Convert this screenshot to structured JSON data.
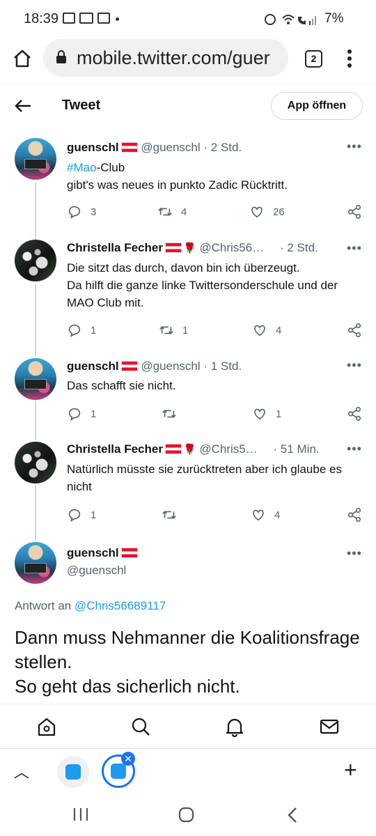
{
  "status_bar": {
    "time": "18:39",
    "battery": "7%"
  },
  "browser": {
    "url": "mobile.twitter.com/guer",
    "tab_count": "2"
  },
  "header": {
    "title": "Tweet",
    "app_button": "App öffnen"
  },
  "tweets": [
    {
      "name": "guenschl",
      "handle": "@guenschl · 2 Std.",
      "hashtag": "#Mao",
      "text_line1_rest": "-Club",
      "text_line2": "gibt's was neues in punkto Zadic Rücktritt.",
      "replies": "3",
      "retweets": "4",
      "likes": "26"
    },
    {
      "name": "Christella Fecher",
      "handle": "@Chris56…",
      "time": "· 2 Std.",
      "text": "Die sitzt das durch, davon bin ich überzeugt.\nDa hilft die ganze linke Twittersonderschule und der MAO Club mit.",
      "replies": "1",
      "retweets": "1",
      "likes": "4"
    },
    {
      "name": "guenschl",
      "handle": "@guenschl · 1 Std.",
      "text": "Das schafft sie nicht.",
      "replies": "1",
      "retweets": "",
      "likes": "1"
    },
    {
      "name": "Christella Fecher",
      "handle": "@Chris5…",
      "time": "· 51 Min.",
      "text": "Natürlich müsste sie zurücktreten aber ich glaube es nicht",
      "replies": "1",
      "retweets": "",
      "likes": "4"
    }
  ],
  "main_tweet": {
    "name": "guenschl",
    "handle": "@guenschl",
    "reply_prefix": "Antwort an ",
    "reply_to": "@Chris56689117",
    "text": "Dann muss Nehmanner die Koalitionsfrage stellen.\nSo geht das sicherlich nicht."
  },
  "colors": {
    "accent": "#1d9bf0",
    "secondary_text": "#536471",
    "chrome_blue": "#1a73e8"
  }
}
